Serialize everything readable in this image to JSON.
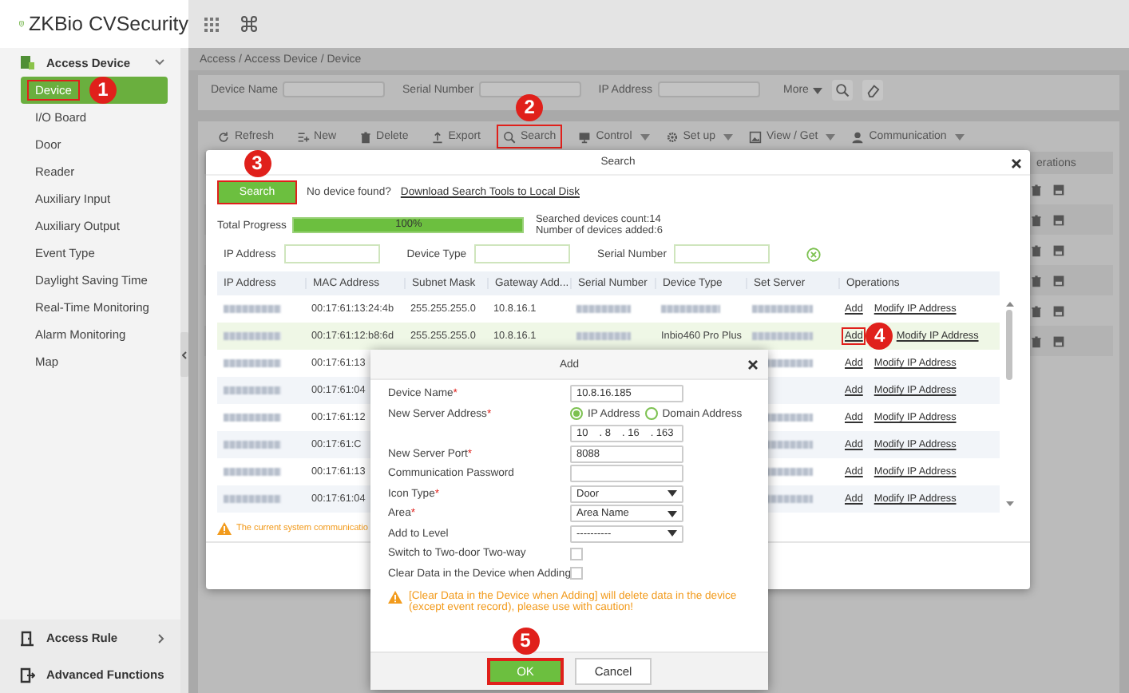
{
  "header": {
    "logo": "ZKBio CVSecurity"
  },
  "sidebar": {
    "section": {
      "label": "Access Device",
      "expanded": true
    },
    "items": [
      {
        "label": "Device",
        "selected": true,
        "highlighted": true,
        "callout": "1"
      },
      {
        "label": "I/O Board",
        "selected": false,
        "highlighted": false
      },
      {
        "label": "Door",
        "selected": false,
        "highlighted": false
      },
      {
        "label": "Reader",
        "selected": false,
        "highlighted": false
      },
      {
        "label": "Auxiliary Input",
        "selected": false,
        "highlighted": false
      },
      {
        "label": "Auxiliary Output",
        "selected": false,
        "highlighted": false
      },
      {
        "label": "Event Type",
        "selected": false,
        "highlighted": false
      },
      {
        "label": "Daylight Saving Time",
        "selected": false,
        "highlighted": false
      },
      {
        "label": "Real-Time Monitoring",
        "selected": false,
        "highlighted": false
      },
      {
        "label": "Alarm Monitoring",
        "selected": false,
        "highlighted": false
      },
      {
        "label": "Map",
        "selected": false,
        "highlighted": false
      }
    ],
    "footer": [
      {
        "label": "Access Rule"
      },
      {
        "label": "Advanced Functions"
      }
    ]
  },
  "breadcrumb": "Access / Access Device / Device",
  "filters": [
    {
      "label": "Device Name"
    },
    {
      "label": "Serial Number"
    },
    {
      "label": "IP Address"
    }
  ],
  "more": "More",
  "toolbar": [
    {
      "label": "Refresh",
      "dropdown": false,
      "highlighted": false
    },
    {
      "label": "New",
      "dropdown": false,
      "highlighted": false
    },
    {
      "label": "Delete",
      "dropdown": false,
      "highlighted": false
    },
    {
      "label": "Export",
      "dropdown": false,
      "highlighted": false
    },
    {
      "label": "Search",
      "dropdown": false,
      "highlighted": true,
      "callout": "2"
    },
    {
      "label": "Control",
      "dropdown": true,
      "highlighted": false
    },
    {
      "label": "Set up",
      "dropdown": true,
      "highlighted": false
    },
    {
      "label": "View / Get",
      "dropdown": true,
      "highlighted": false
    },
    {
      "label": "Communication",
      "dropdown": true,
      "highlighted": false
    }
  ],
  "device_table": {
    "column": "erations"
  },
  "search_dialog": {
    "title": "Search",
    "search_button": {
      "label": "Search",
      "highlighted": true,
      "callout": "3"
    },
    "hint": "No device found?",
    "link": "Download Search Tools to Local Disk",
    "progress": {
      "label": "Total Progress",
      "level": 1,
      "reading": "100%"
    },
    "stats": [
      "Searched devices count:14",
      "Number of devices added:6"
    ],
    "filters": [
      {
        "label": "IP Address"
      },
      {
        "label": "Device Type"
      },
      {
        "label": "Serial Number"
      }
    ],
    "columns": [
      "IP Address",
      "MAC Address",
      "Subnet Mask",
      "Gateway Add...",
      "Serial Number",
      "Device Type",
      "Set Server",
      "Operations"
    ],
    "rows": [
      {
        "selected": false,
        "cells": [
          {
            "kind": "blurred"
          },
          {
            "kind": "text",
            "text": "00:17:61:13:24:4b"
          },
          {
            "kind": "text",
            "text": "255.255.255.0"
          },
          {
            "kind": "text",
            "text": "10.8.16.1"
          },
          {
            "kind": "blurred"
          },
          {
            "kind": "blurred"
          },
          {
            "kind": "blurred"
          },
          {
            "kind": "links",
            "links": [
              {
                "label": "Add",
                "highlighted": false
              },
              {
                "label": "Modify IP Address",
                "highlighted": false
              }
            ]
          }
        ]
      },
      {
        "selected": true,
        "cells": [
          {
            "kind": "blurred"
          },
          {
            "kind": "text",
            "text": "00:17:61:12:b8:6d"
          },
          {
            "kind": "text",
            "text": "255.255.255.0"
          },
          {
            "kind": "text",
            "text": "10.8.16.1"
          },
          {
            "kind": "blurred"
          },
          {
            "kind": "text",
            "text": "Inbio460 Pro Plus"
          },
          {
            "kind": "blurred"
          },
          {
            "kind": "links",
            "links": [
              {
                "label": "Add",
                "highlighted": true,
                "callout": "4"
              },
              {
                "label": "Modify IP Address",
                "highlighted": false
              }
            ]
          }
        ]
      },
      {
        "selected": false,
        "cells": [
          {
            "kind": "blurred"
          },
          {
            "kind": "text",
            "text": "00:17:61:13"
          },
          {
            "kind": "empty"
          },
          {
            "kind": "empty"
          },
          {
            "kind": "empty"
          },
          {
            "kind": "empty"
          },
          {
            "kind": "blurred"
          },
          {
            "kind": "links",
            "links": [
              {
                "label": "Add",
                "highlighted": false
              },
              {
                "label": "Modify IP Address",
                "highlighted": false
              }
            ]
          }
        ]
      },
      {
        "selected": false,
        "cells": [
          {
            "kind": "blurred"
          },
          {
            "kind": "text",
            "text": "00:17:61:04"
          },
          {
            "kind": "empty"
          },
          {
            "kind": "empty"
          },
          {
            "kind": "empty"
          },
          {
            "kind": "empty"
          },
          {
            "kind": "empty"
          },
          {
            "kind": "links",
            "links": [
              {
                "label": "Add",
                "highlighted": false
              },
              {
                "label": "Modify IP Address",
                "highlighted": false
              }
            ]
          }
        ]
      },
      {
        "selected": false,
        "cells": [
          {
            "kind": "blurred"
          },
          {
            "kind": "text",
            "text": "00:17:61:12"
          },
          {
            "kind": "empty"
          },
          {
            "kind": "empty"
          },
          {
            "kind": "empty"
          },
          {
            "kind": "empty"
          },
          {
            "kind": "blurred"
          },
          {
            "kind": "links",
            "links": [
              {
                "label": "Add",
                "highlighted": false
              },
              {
                "label": "Modify IP Address",
                "highlighted": false
              }
            ]
          }
        ]
      },
      {
        "selected": false,
        "cells": [
          {
            "kind": "blurred"
          },
          {
            "kind": "text",
            "text": "00:17:61:C"
          },
          {
            "kind": "empty"
          },
          {
            "kind": "empty"
          },
          {
            "kind": "empty"
          },
          {
            "kind": "empty"
          },
          {
            "kind": "blurred"
          },
          {
            "kind": "links",
            "links": [
              {
                "label": "Add",
                "highlighted": false
              },
              {
                "label": "Modify IP Address",
                "highlighted": false
              }
            ]
          }
        ]
      },
      {
        "selected": false,
        "cells": [
          {
            "kind": "blurred"
          },
          {
            "kind": "text",
            "text": "00:17:61:13"
          },
          {
            "kind": "empty"
          },
          {
            "kind": "empty"
          },
          {
            "kind": "empty"
          },
          {
            "kind": "empty"
          },
          {
            "kind": "blurred"
          },
          {
            "kind": "links",
            "links": [
              {
                "label": "Add",
                "highlighted": false
              },
              {
                "label": "Modify IP Address",
                "highlighted": false
              }
            ]
          }
        ]
      },
      {
        "selected": false,
        "cells": [
          {
            "kind": "blurred"
          },
          {
            "kind": "text",
            "text": "00:17:61:04"
          },
          {
            "kind": "empty"
          },
          {
            "kind": "empty"
          },
          {
            "kind": "empty"
          },
          {
            "kind": "empty"
          },
          {
            "kind": "blurred"
          },
          {
            "kind": "links",
            "links": [
              {
                "label": "Add",
                "highlighted": false
              },
              {
                "label": "Modify IP Address",
                "highlighted": false
              }
            ]
          }
        ]
      }
    ],
    "warning": "The current system communicatio"
  },
  "add_dialog": {
    "title": "Add",
    "fields": [
      {
        "kind": "text",
        "label": "Device Name",
        "mark": "*",
        "value": "10.8.16.185"
      },
      {
        "kind": "radio",
        "label": "New Server Address",
        "mark": "*",
        "options": [
          {
            "label": "IP Address",
            "selected": true
          },
          {
            "label": "Domain Address",
            "selected": false
          }
        ]
      },
      {
        "kind": "ip",
        "parts": [
          "10",
          "8",
          "16",
          "163"
        ],
        "separator": "."
      },
      {
        "kind": "text",
        "label": "New Server Port",
        "mark": "*",
        "value": "8088"
      },
      {
        "kind": "text",
        "label": "Communication Password"
      },
      {
        "kind": "select",
        "label": "Icon Type",
        "mark": "*",
        "value": "Door"
      },
      {
        "kind": "select",
        "label": "Area",
        "mark": "*",
        "value": "Area Name"
      },
      {
        "kind": "select",
        "label": "Add to Level",
        "value": "----------"
      },
      {
        "kind": "checkbox",
        "label": "Switch to Two-door Two-way",
        "checked": false
      },
      {
        "kind": "checkbox",
        "label": "Clear Data in the Device when Adding",
        "checked": false
      }
    ],
    "warning": "[Clear Data in the Device when Adding] will delete data in the device (except event record), please use with caution!",
    "buttons": [
      {
        "label": "OK",
        "kind": "primary",
        "highlighted": true,
        "callout": "5"
      },
      {
        "label": "Cancel",
        "kind": "secondary",
        "highlighted": false
      }
    ]
  }
}
